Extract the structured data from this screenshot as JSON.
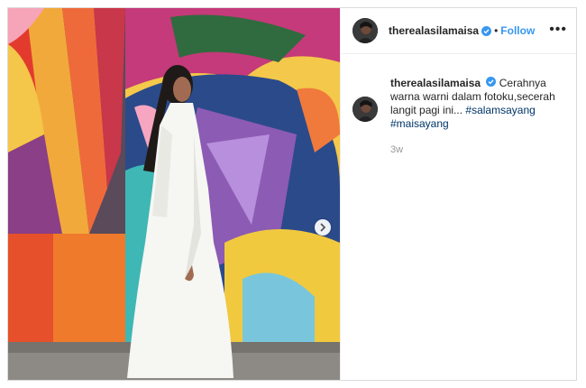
{
  "post": {
    "username": "therealasilamaisa",
    "follow_label": "Follow",
    "separator": "•",
    "more_label": "•••",
    "caption_prefix": "Cerahnya warna warni dalam fotoku,secerah langit pagi ini...",
    "hashtags": [
      "#salamsayang",
      "#maisayang"
    ],
    "time_ago": "3w",
    "icons": [
      "verified-badge-icon",
      "more-options-icon",
      "next-chevron-icon"
    ],
    "colors": {
      "accent": "#3897f0",
      "hashtag": "#003569",
      "muted": "#999999"
    }
  }
}
